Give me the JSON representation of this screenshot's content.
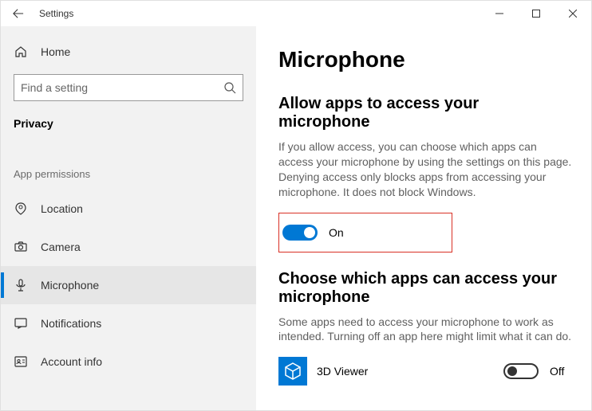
{
  "titlebar": {
    "title": "Settings"
  },
  "sidebar": {
    "home_label": "Home",
    "search_placeholder": "Find a setting",
    "category": "Privacy",
    "section_label": "App permissions",
    "items": [
      {
        "label": "Location"
      },
      {
        "label": "Camera"
      },
      {
        "label": "Microphone"
      },
      {
        "label": "Notifications"
      },
      {
        "label": "Account info"
      }
    ]
  },
  "main": {
    "title": "Microphone",
    "allow": {
      "heading": "Allow apps to access your microphone",
      "description": "If you allow access, you can choose which apps can access your microphone by using the settings on this page. Denying access only blocks apps from accessing your microphone. It does not block Windows.",
      "toggle_label": "On"
    },
    "choose": {
      "heading": "Choose which apps can access your microphone",
      "description": "Some apps need to access your microphone to work as intended. Turning off an app here might limit what it can do."
    },
    "apps": [
      {
        "name": "3D Viewer",
        "state_label": "Off"
      }
    ]
  }
}
